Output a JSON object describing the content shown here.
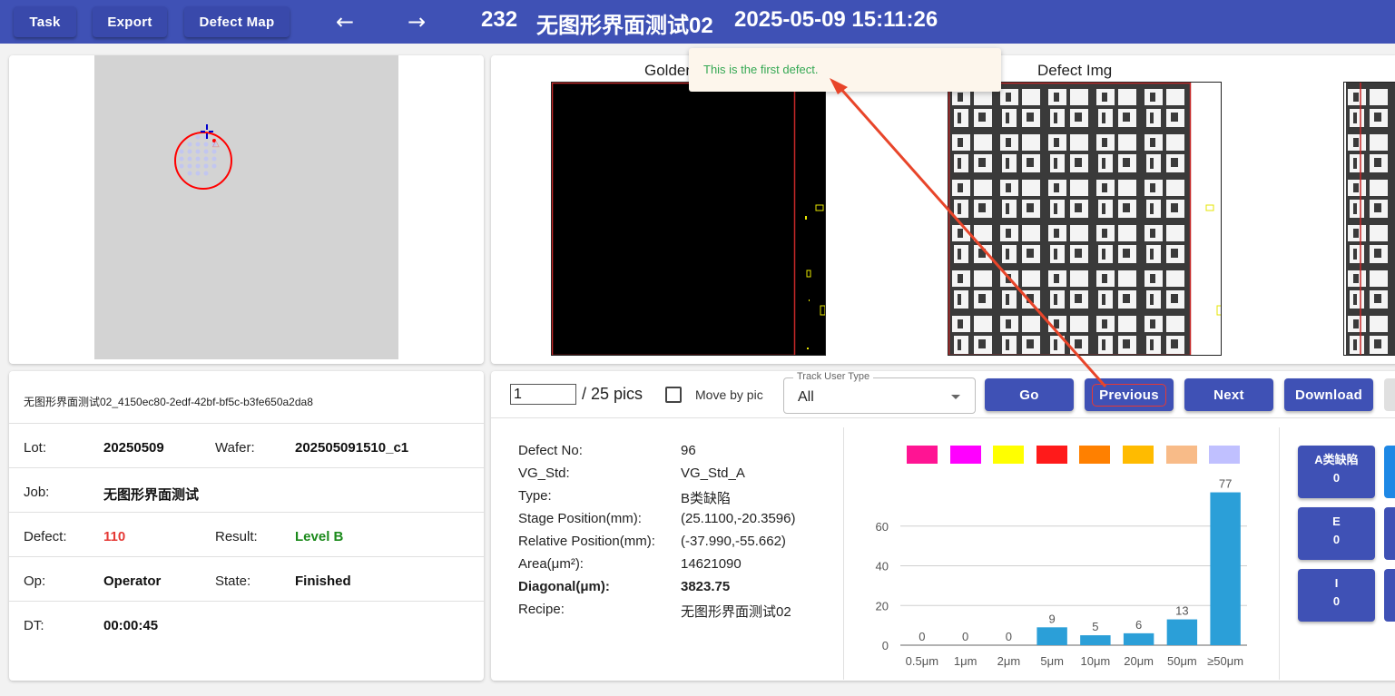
{
  "header": {
    "task_label": "Task",
    "export_label": "Export",
    "defect_map_label": "Defect Map",
    "back_icon": "←",
    "forward_icon": "→",
    "id": "232",
    "name": "无图形界面测试02",
    "datetime": "2025-05-09 15:11:26"
  },
  "toast": {
    "message": "This is the first defect."
  },
  "images": {
    "golden_label": "Golden",
    "defect_label": "Defect Img"
  },
  "info": {
    "file_name": "无图形界面测试02_4150ec80-2edf-42bf-bf5c-b3fe650a2da8",
    "lot_label": "Lot:",
    "lot_value": "20250509",
    "wafer_label": "Wafer:",
    "wafer_value": "202505091510_c1",
    "job_label": "Job:",
    "job_value": "无图形界面测试",
    "defect_label": "Defect:",
    "defect_value": "110",
    "result_label": "Result:",
    "result_value": "Level B",
    "op_label": "Op:",
    "op_value": "Operator",
    "state_label": "State:",
    "state_value": "Finished",
    "dt_label": "DT:",
    "dt_value": "00:00:45"
  },
  "controls": {
    "pic_index": "1",
    "pic_total": "/ 25 pics",
    "move_by_pic_label": "Move by pic",
    "track_user_type_label": "Track User Type",
    "track_user_type_value": "All",
    "go_label": "Go",
    "previous_label": "Previous",
    "next_label": "Next",
    "download_label": "Download"
  },
  "details": [
    {
      "label": "Defect No:",
      "value": "96",
      "bold": false
    },
    {
      "label": "VG_Std:",
      "value": "VG_Std_A",
      "bold": false
    },
    {
      "label": "Type:",
      "value": "B类缺陷",
      "bold": false
    },
    {
      "label": "Stage Position(mm):",
      "value": "(25.1100,-20.3596)",
      "bold": false
    },
    {
      "label": "Relative Position(mm):",
      "value": "(-37.990,-55.662)",
      "bold": false
    },
    {
      "label": "Area(μm²):",
      "value": "14621090",
      "bold": false
    },
    {
      "label": "Diagonal(μm):",
      "value": "3823.75",
      "bold": true
    },
    {
      "label": "Recipe:",
      "value": "无图形界面测试02",
      "bold": false
    }
  ],
  "colors": {
    "accent": "#3f51b5",
    "bar": "#2b9fd8",
    "defect_red": "#e53935",
    "level_green": "#1b8a1b",
    "toast_green": "#34a853",
    "swatches": [
      "#ff1493",
      "#ff00ff",
      "#ffff00",
      "#ff1a1a",
      "#ff8000",
      "#ffbb00",
      "#f8bb88",
      "#c0c0ff"
    ]
  },
  "chart_data": {
    "type": "bar",
    "categories": [
      "0.5μm",
      "1μm",
      "2μm",
      "5μm",
      "10μm",
      "20μm",
      "50μm",
      "≥50μm"
    ],
    "values": [
      0,
      0,
      0,
      9,
      5,
      6,
      13,
      77
    ],
    "ylim": [
      0,
      80
    ],
    "yticks": [
      0,
      20,
      40,
      60
    ],
    "grid": true
  },
  "categories_panel": [
    {
      "name": "A类缺陷",
      "count": "0"
    },
    {
      "name": "E",
      "count": "0"
    },
    {
      "name": "I",
      "count": "0"
    }
  ]
}
